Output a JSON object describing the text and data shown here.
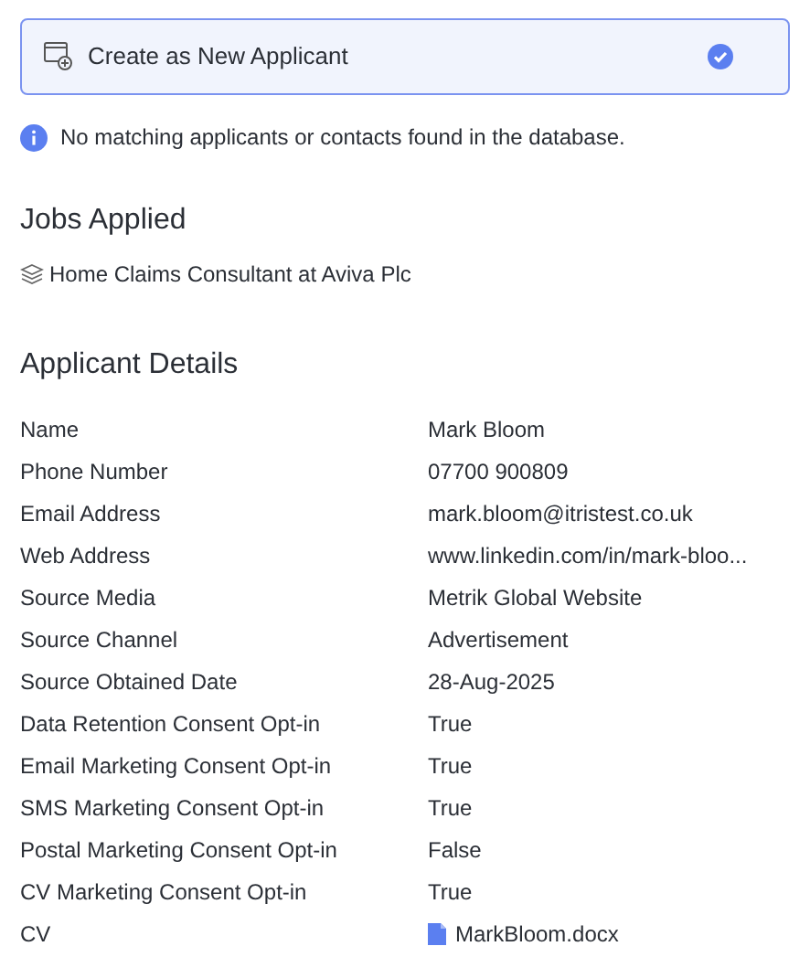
{
  "option": {
    "label": "Create as New Applicant",
    "selected": true
  },
  "notice": "No matching applicants or contacts found in the database.",
  "jobs": {
    "title": "Jobs Applied",
    "items": [
      "Home Claims Consultant at Aviva Plc"
    ]
  },
  "details": {
    "title": "Applicant Details",
    "rows": [
      {
        "label": "Name",
        "value": "Mark Bloom",
        "kind": "text"
      },
      {
        "label": "Phone Number",
        "value": "07700 900809",
        "kind": "text"
      },
      {
        "label": "Email Address",
        "value": "mark.bloom@itristest.co.uk",
        "kind": "text"
      },
      {
        "label": "Web Address",
        "value": "www.linkedin.com/in/mark-bloo...",
        "kind": "text"
      },
      {
        "label": "Source Media",
        "value": "Metrik Global Website",
        "kind": "text"
      },
      {
        "label": "Source Channel",
        "value": "Advertisement",
        "kind": "text"
      },
      {
        "label": "Source Obtained Date",
        "value": "28-Aug-2025",
        "kind": "text"
      },
      {
        "label": "Data Retention Consent Opt-in",
        "value": "True",
        "kind": "text"
      },
      {
        "label": "Email Marketing Consent Opt-in",
        "value": "True",
        "kind": "text"
      },
      {
        "label": "SMS Marketing Consent Opt-in",
        "value": "True",
        "kind": "text"
      },
      {
        "label": "Postal Marketing Consent Opt-in",
        "value": "False",
        "kind": "text"
      },
      {
        "label": "CV Marketing Consent Opt-in",
        "value": "True",
        "kind": "text"
      },
      {
        "label": "CV",
        "value": "MarkBloom.docx",
        "kind": "file"
      }
    ]
  }
}
